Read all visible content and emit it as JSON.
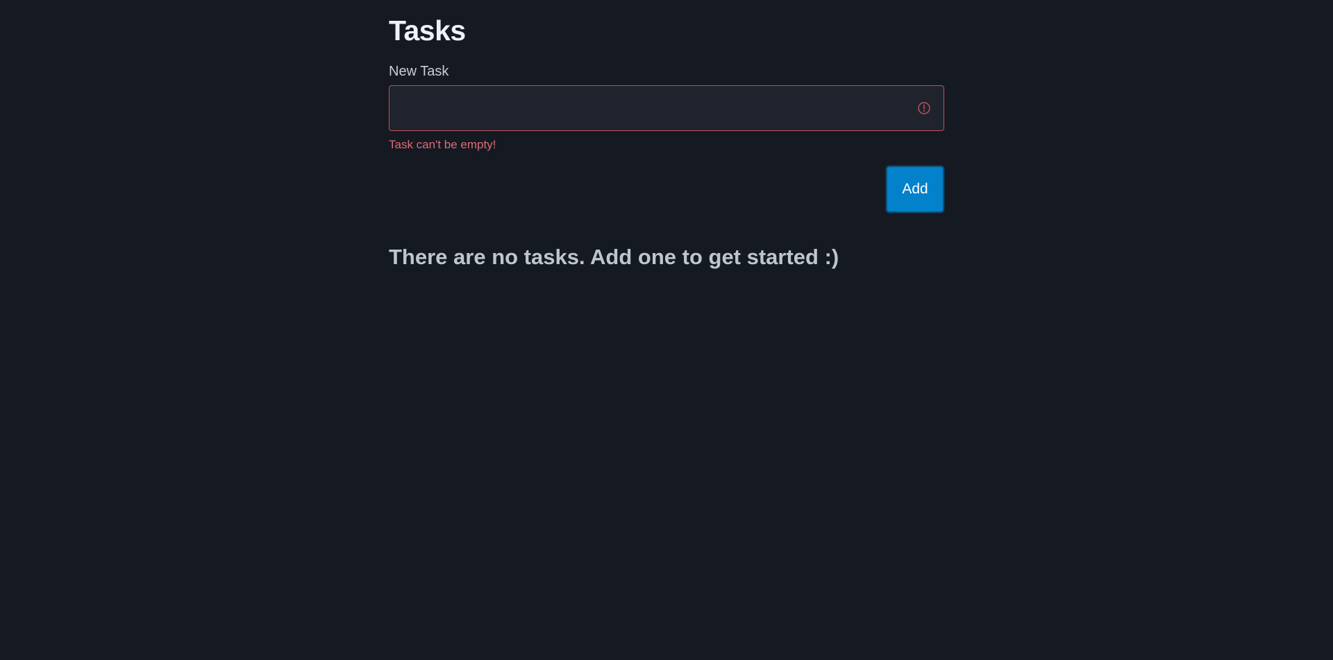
{
  "page": {
    "title": "Tasks"
  },
  "form": {
    "label": "New Task",
    "input_value": "",
    "input_placeholder": "",
    "error_message": "Task can't be empty!",
    "error_icon": "alert-circle-icon",
    "add_label": "Add"
  },
  "tasks": {
    "empty_message": "There are no tasks. Add one to get started :)"
  },
  "colors": {
    "background": "#141922",
    "input_background": "#1f232d",
    "error": "#e06b73",
    "error_border": "#c1535e",
    "accent": "#0381cb"
  }
}
